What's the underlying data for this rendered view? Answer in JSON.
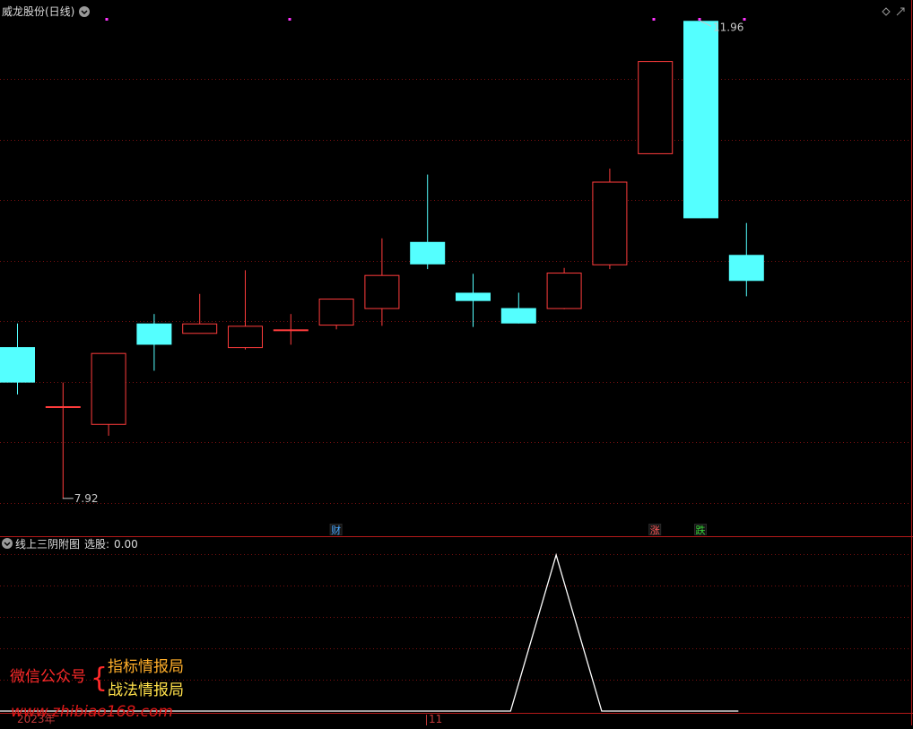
{
  "colors": {
    "background": "#000000",
    "up": "#ff3c3c",
    "down": "#54ffff",
    "grid": "#7a1010",
    "separator": "#b41a1a",
    "marker": "#ff33ff",
    "indicator_line": "#ffffff"
  },
  "header": {
    "title": "威龙股份(日线)",
    "menu_icon": "chevron-down-icon",
    "corner_icons": [
      "diamond-icon",
      "maximize-icon"
    ]
  },
  "price_labels": {
    "high": "11.96",
    "low": "7.92"
  },
  "events": [
    {
      "label": "财",
      "candle": 7,
      "color": "#4aa8ff"
    },
    {
      "label": "涨",
      "candle": 14,
      "color": "#ff5a5a"
    },
    {
      "label": "跌",
      "candle": 15,
      "color": "#38d838"
    }
  ],
  "indicator": {
    "name": "线上三阴附图",
    "field_label": "选股:",
    "field_value": "0.00"
  },
  "x_axis": {
    "labels": [
      "2023年",
      "11"
    ]
  },
  "watermark": {
    "account_label": "微信公众号",
    "brace": "{",
    "line1": "指标情报局",
    "line2": "战法情报局",
    "url": "www.zhibiao168.com"
  },
  "chart_data": [
    {
      "type": "candlestick",
      "title": "威龙股份(日线)",
      "ylim": [
        7.6,
        12.0
      ],
      "max_label": 11.96,
      "min_label": 7.92,
      "candles": [
        {
          "open": 9.2,
          "high": 9.4,
          "low": 8.8,
          "close": 8.9
        },
        {
          "open": 8.7,
          "high": 8.9,
          "low": 7.92,
          "close": 8.7
        },
        {
          "open": 8.55,
          "high": 9.05,
          "low": 8.45,
          "close": 9.15
        },
        {
          "open": 9.4,
          "high": 9.48,
          "low": 9.0,
          "close": 9.22
        },
        {
          "open": 9.32,
          "high": 9.65,
          "low": 9.32,
          "close": 9.4
        },
        {
          "open": 9.2,
          "high": 9.85,
          "low": 9.18,
          "close": 9.38
        },
        {
          "open": 9.35,
          "high": 9.48,
          "low": 9.22,
          "close": 9.35
        },
        {
          "open": 9.39,
          "high": 9.59,
          "low": 9.35,
          "close": 9.61
        },
        {
          "open": 9.53,
          "high": 10.12,
          "low": 9.38,
          "close": 9.81
        },
        {
          "open": 10.09,
          "high": 10.66,
          "low": 9.86,
          "close": 9.9
        },
        {
          "open": 9.66,
          "high": 9.82,
          "low": 9.37,
          "close": 9.59
        },
        {
          "open": 9.53,
          "high": 9.66,
          "low": 9.4,
          "close": 9.4
        },
        {
          "open": 9.53,
          "high": 9.87,
          "low": 9.52,
          "close": 9.83
        },
        {
          "open": 9.9,
          "high": 10.71,
          "low": 9.86,
          "close": 10.6
        },
        {
          "open": 10.84,
          "high": 11.62,
          "low": 10.84,
          "close": 11.62
        },
        {
          "open": 11.96,
          "high": 11.96,
          "low": 10.29,
          "close": 10.29
        },
        {
          "open": 9.98,
          "high": 10.25,
          "low": 9.63,
          "close": 9.76
        }
      ]
    },
    {
      "type": "line",
      "title": "线上三阴附图",
      "series": [
        {
          "name": "选股",
          "values": [
            0,
            0,
            0,
            0,
            0,
            0,
            0,
            0,
            0,
            0,
            0,
            0,
            1,
            0,
            0,
            0,
            0
          ]
        }
      ],
      "ylim": [
        0,
        1
      ]
    }
  ]
}
